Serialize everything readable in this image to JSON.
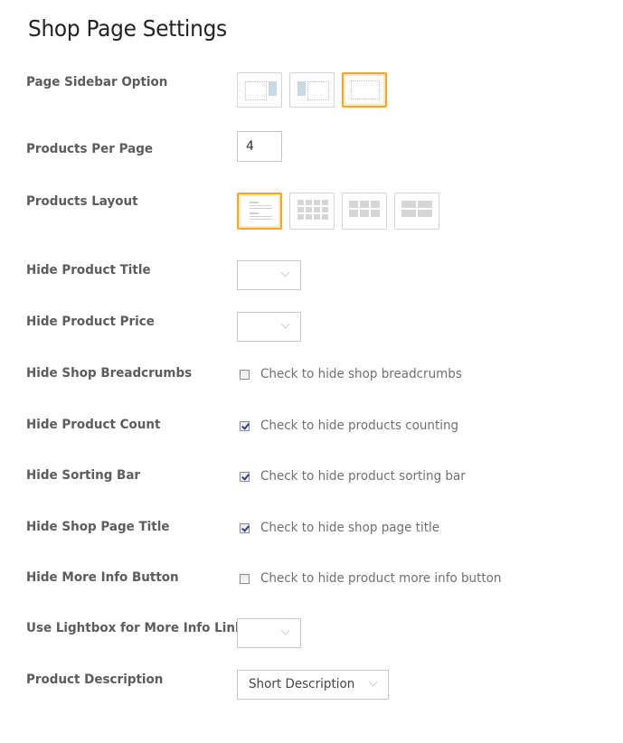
{
  "page": {
    "title": "Shop Page Settings"
  },
  "colors": {
    "selected_border": "#f5a623",
    "sidebar_block": "#c9d9e1",
    "check_mark": "#2a3f8f"
  },
  "settings": {
    "sidebar_option": {
      "label": "Page Sidebar Option",
      "options": [
        {
          "name": "right-sidebar",
          "icon": "right-sidebar-icon"
        },
        {
          "name": "left-sidebar",
          "icon": "left-sidebar-icon"
        },
        {
          "name": "no-sidebar",
          "icon": "no-sidebar-icon"
        }
      ],
      "selected": "no-sidebar"
    },
    "products_per_page": {
      "label": "Products Per Page",
      "value": "4"
    },
    "products_layout": {
      "label": "Products Layout",
      "options": [
        {
          "name": "list",
          "icon": "list-layout-icon"
        },
        {
          "name": "4-columns",
          "icon": "grid-4-columns-icon"
        },
        {
          "name": "3-columns",
          "icon": "grid-3-columns-icon"
        },
        {
          "name": "2-columns",
          "icon": "grid-2-columns-icon"
        }
      ],
      "selected": "list"
    },
    "hide_product_title": {
      "label": "Hide Product Title",
      "value": ""
    },
    "hide_product_price": {
      "label": "Hide Product Price",
      "value": ""
    },
    "hide_shop_breadcrumbs": {
      "label": "Hide Shop Breadcrumbs",
      "checkbox_label": "Check to hide shop breadcrumbs",
      "checked": false
    },
    "hide_product_count": {
      "label": "Hide Product Count",
      "checkbox_label": "Check to hide products counting",
      "checked": true
    },
    "hide_sorting_bar": {
      "label": "Hide Sorting Bar",
      "checkbox_label": "Check to hide product sorting bar",
      "checked": true
    },
    "hide_shop_page_title": {
      "label": "Hide Shop Page Title",
      "checkbox_label": "Check to hide shop page title",
      "checked": true
    },
    "hide_more_info_button": {
      "label": "Hide More Info Button",
      "checkbox_label": "Check to hide product more info button",
      "checked": false
    },
    "use_lightbox": {
      "label": "Use Lightbox for More Info Link",
      "value": ""
    },
    "product_description": {
      "label": "Product Description",
      "value": "Short Description"
    }
  }
}
